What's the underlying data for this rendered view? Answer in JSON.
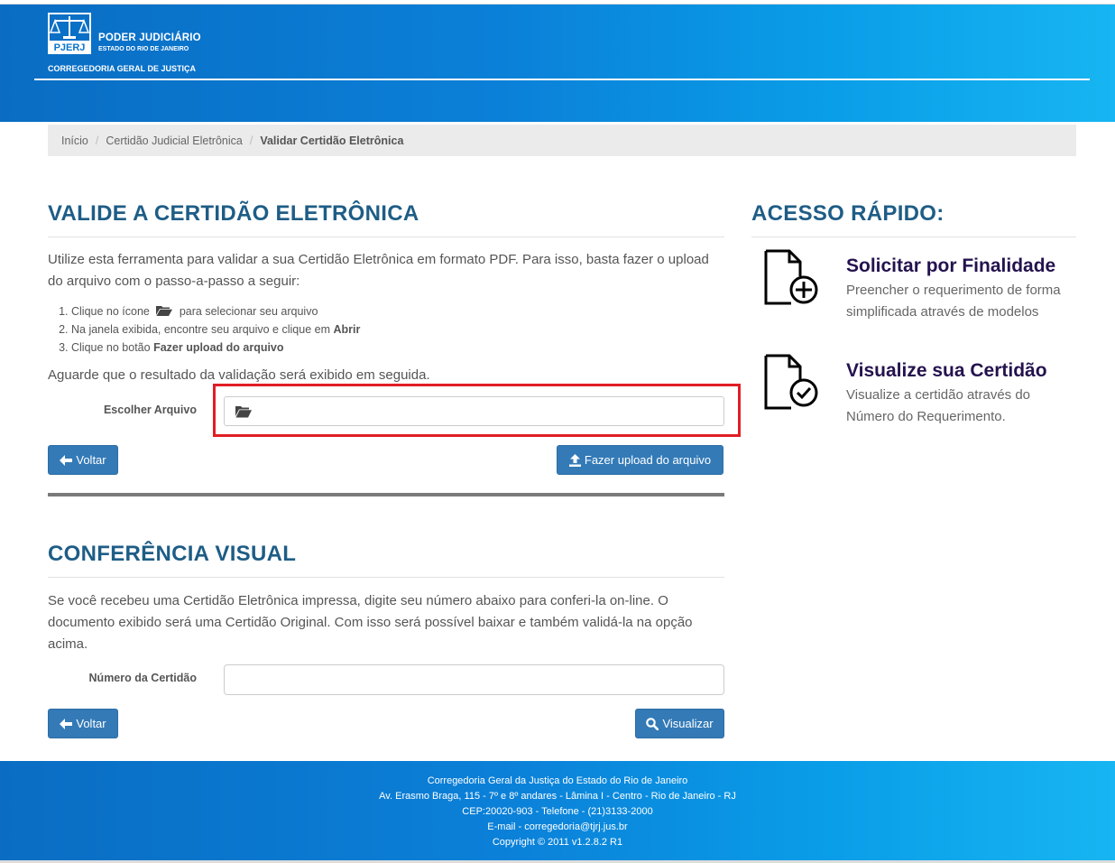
{
  "header": {
    "logo_abbr": "PJERJ",
    "title": "PODER JUDICIÁRIO",
    "subtitle": "ESTADO DO RIO DE JANEIRO",
    "department": "CORREGEDORIA GERAL DE JUSTIÇA"
  },
  "breadcrumb": {
    "items": [
      "Início",
      "Certidão Judicial Eletrônica",
      "Validar Certidão Eletrônica"
    ]
  },
  "validate": {
    "heading": "VALIDE A CERTIDÃO ELETRÔNICA",
    "intro": "Utilize esta ferramenta para validar a sua Certidão Eletrônica em formato PDF. Para isso, basta fazer o upload do arquivo com o passo-a-passo a seguir:",
    "step1_prefix": "Clique no ícone",
    "step1_suffix": "para selecionar seu arquivo",
    "step2_prefix": "Na janela exibida, encontre seu arquivo e clique em",
    "step2_bold": "Abrir",
    "step3_prefix": "Clique no botão",
    "step3_bold": "Fazer upload do arquivo",
    "wait_text": "Aguarde que o resultado da validação será exibido em seguida.",
    "file_label": "Escolher Arquivo",
    "back_label": "Voltar",
    "upload_label": "Fazer upload do arquivo"
  },
  "visual": {
    "heading": "CONFERÊNCIA VISUAL",
    "intro": "Se você recebeu uma Certidão Eletrônica impressa, digite seu número abaixo para conferi-la on-line. O documento exibido será uma Certidão Original. Com isso será possível baixar e também validá-la na opção acima.",
    "number_label": "Número da Certidão",
    "back_label": "Voltar",
    "view_label": "Visualizar"
  },
  "quick_access": {
    "heading": "ACESSO RÁPIDO:",
    "items": [
      {
        "title": "Solicitar por Finalidade",
        "desc": "Preencher o requerimento de forma simplificada através de modelos",
        "icon": "document-plus-icon"
      },
      {
        "title": "Visualize sua Certidão",
        "desc": "Visualize a certidão através do Número do Requerimento.",
        "icon": "document-check-icon"
      }
    ]
  },
  "footer": {
    "lines": [
      "Corregedoria Geral da Justiça do Estado do Rio de Janeiro",
      "Av. Erasmo Braga, 115 - 7º e 8º andares - Lâmina I - Centro - Rio de Janeiro - RJ",
      "CEP:20020-903 - Telefone - (21)3133-2000",
      "E-mail - corregedoria@tjrj.jus.br",
      "Copyright © 2011 v1.2.8.2 R1"
    ]
  },
  "colors": {
    "header_blue": "#0b80d8",
    "heading_blue": "#1e5d86",
    "quick_title": "#24124e",
    "button_blue": "#337ab7",
    "highlight_red": "#e01e24"
  }
}
